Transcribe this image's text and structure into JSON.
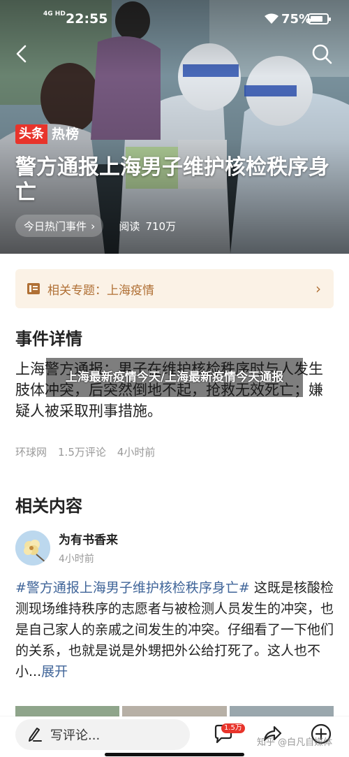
{
  "status_bar": {
    "network": "4G HD",
    "time": "22:55",
    "battery": "75%",
    "battery_level": 0.75
  },
  "nav": {
    "back_icon": "chevron-left-icon",
    "search_icon": "search-icon"
  },
  "hero": {
    "brand_tag": "头条",
    "brand_text": "热榜",
    "title": "警方通报上海男子维护核检秩序身亡",
    "chip_label": "今日热门事件",
    "reads_label": "阅读",
    "reads_value": "710万"
  },
  "topic": {
    "label": "相关专题：",
    "value": "上海疫情",
    "icon": "document-icon"
  },
  "event": {
    "section_title": "事件详情",
    "body": "上海警方通报：男子在维护核检秩序时与人发生肢体冲突，后突然倒地不起，抢救无效死亡；嫌疑人被采取刑事措施。",
    "source": "环球网",
    "comments": "1.5万评论",
    "time": "4小时前"
  },
  "related": {
    "section_title": "相关内容",
    "author": "为有书香来",
    "author_time": "4小时前",
    "hashtag": "#警方通报上海男子维护核检秩序身亡#",
    "post_text": " 这既是核酸检测现场维持秩序的志愿者与被检测人员发生的冲突，也是自己家人的亲戚之间发生的冲突。仔细看了一下他们的关系，也就是说是外甥把外公给打死了。这人也不小...",
    "expand": "展开"
  },
  "overlay": {
    "caption": "上海最新疫情今天/上海最新疫情今天通报"
  },
  "bottom_bar": {
    "comment_placeholder": "写评论...",
    "comment_badge": "1.5万",
    "watermark": "知乎 @白凡自媒体"
  },
  "colors": {
    "brand_red": "#e8342b",
    "topic_bg": "#fbf2e6",
    "topic_text": "#b07035",
    "link_blue": "#406599"
  }
}
